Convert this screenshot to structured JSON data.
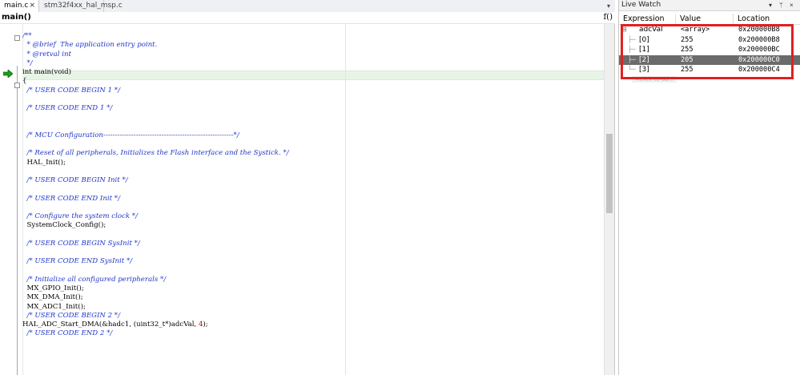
{
  "editor": {
    "tabs": [
      {
        "label": "main.c",
        "close": "×",
        "active": true
      },
      {
        "label": "stm32f4xx_hal_msp.c",
        "active": false
      }
    ],
    "tab_overflow": "▾",
    "function_name": "main()",
    "function_icon": "f()",
    "code_lines": [
      {
        "text": "/**",
        "kind": "cm"
      },
      {
        "text": "  * @brief  The application entry point.",
        "kind": "cm"
      },
      {
        "text": "  * @retval int",
        "kind": "cm"
      },
      {
        "text": "  */",
        "kind": "cm"
      },
      {
        "text": "int main(void)",
        "kind": "fn"
      },
      {
        "text": "{",
        "kind": "brace"
      },
      {
        "text": "  /* USER CODE BEGIN 1 */",
        "kind": "cm"
      },
      {
        "text": "",
        "kind": "blank"
      },
      {
        "text": "  /* USER CODE END 1 */",
        "kind": "cm"
      },
      {
        "text": "",
        "kind": "blank"
      },
      {
        "text": "",
        "kind": "blank"
      },
      {
        "text": "  /* MCU Configuration--------------------------------------------------------*/",
        "kind": "cm"
      },
      {
        "text": "",
        "kind": "blank"
      },
      {
        "text": "  /* Reset of all peripherals, Initializes the Flash interface and the Systick. */",
        "kind": "cm"
      },
      {
        "text": "  HAL_Init();",
        "kind": "code"
      },
      {
        "text": "",
        "kind": "blank"
      },
      {
        "text": "  /* USER CODE BEGIN Init */",
        "kind": "cm"
      },
      {
        "text": "",
        "kind": "blank"
      },
      {
        "text": "  /* USER CODE END Init */",
        "kind": "cm"
      },
      {
        "text": "",
        "kind": "blank"
      },
      {
        "text": "  /* Configure the system clock */",
        "kind": "cm"
      },
      {
        "text": "  SystemClock_Config();",
        "kind": "code"
      },
      {
        "text": "",
        "kind": "blank"
      },
      {
        "text": "  /* USER CODE BEGIN SysInit */",
        "kind": "cm"
      },
      {
        "text": "",
        "kind": "blank"
      },
      {
        "text": "  /* USER CODE END SysInit */",
        "kind": "cm"
      },
      {
        "text": "",
        "kind": "blank"
      },
      {
        "text": "  /* Initialize all configured peripherals */",
        "kind": "cm"
      },
      {
        "text": "  MX_GPIO_Init();",
        "kind": "code"
      },
      {
        "text": "  MX_DMA_Init();",
        "kind": "code"
      },
      {
        "text": "  MX_ADC1_Init();",
        "kind": "code"
      },
      {
        "text": "  /* USER CODE BEGIN 2 */",
        "kind": "cm"
      },
      {
        "text": "HAL_ADC_Start_DMA(&hadc1, (uint32_t*)adcVal, 4);",
        "kind": "code"
      },
      {
        "text": "  /* USER CODE END 2 */",
        "kind": "cm"
      }
    ]
  },
  "watch": {
    "title": "Live Watch",
    "title_buttons": {
      "menu": "▾",
      "pin": "ᛘ",
      "close": "×"
    },
    "columns": {
      "expression": "Expression",
      "value": "Value",
      "location": "Location"
    },
    "rows": [
      {
        "expander": "⊟",
        "tree": "",
        "expression": "adcVal",
        "value": "<array>",
        "location": "0x200000B8",
        "selected": false
      },
      {
        "expander": "",
        "tree": "├─",
        "expression": "[0]",
        "value": "255",
        "location": "0x200000B8",
        "selected": false
      },
      {
        "expander": "",
        "tree": "├─",
        "expression": "[1]",
        "value": "255",
        "location": "0x200000BC",
        "selected": false
      },
      {
        "expander": "",
        "tree": "├─",
        "expression": "[2]",
        "value": "205",
        "location": "0x200000C0",
        "selected": true
      },
      {
        "expander": "",
        "tree": "└─",
        "expression": "[3]",
        "value": "255",
        "location": "0x200000C4",
        "selected": false
      }
    ],
    "add_placeholder": "<click to ad..."
  },
  "colors": {
    "highlight_box": "#e02020",
    "comment": "#1f35c9",
    "current_line": "#e7f5e7",
    "exec_arrow": "#1e9b1e",
    "selected_row": "#6b6b6b"
  }
}
